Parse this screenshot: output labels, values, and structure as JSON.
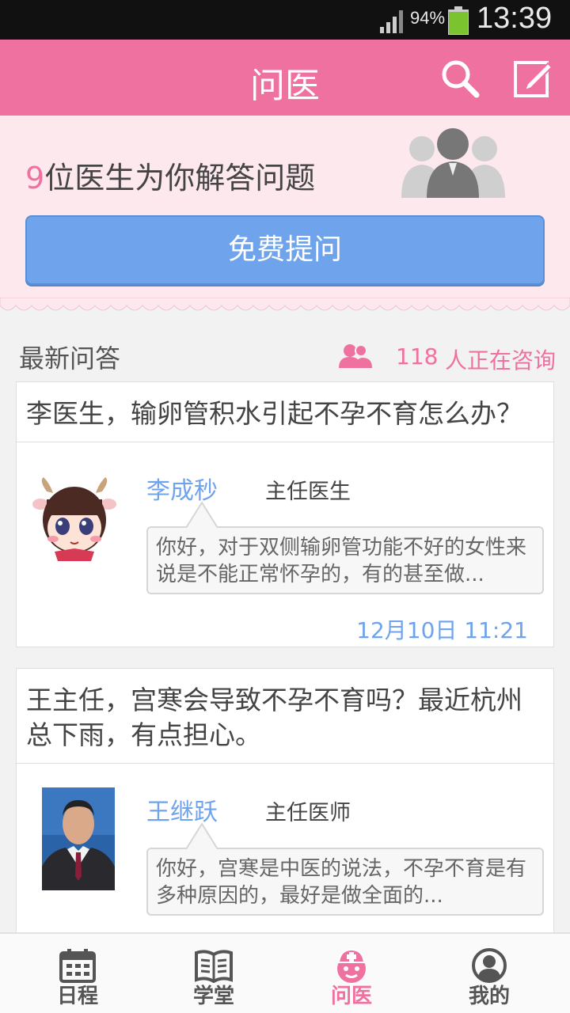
{
  "status_bar": {
    "battery": "94%",
    "time": "13:39"
  },
  "header": {
    "title": "问医",
    "search_icon": "search-icon",
    "compose_icon": "compose-icon"
  },
  "banner": {
    "doctor_count": "9",
    "text": "位医生为你解答问题",
    "ask_button": "免费提问",
    "icon": "doctors-group-icon"
  },
  "section": {
    "title": "最新问答",
    "online_count": "118",
    "online_text": "人正在咨询",
    "icon": "people-icon"
  },
  "questions": [
    {
      "question": "李医生，输卵管积水引起不孕不育怎么办？",
      "doctor_name": "李成秒",
      "doctor_title": "主任医生",
      "answer": "你好，对于双侧输卵管功能不好的女性来说是不能正常怀孕的，有的甚至做...",
      "time": "12月10日 11:21",
      "avatar": "cartoon-girl-avatar"
    },
    {
      "question": "王主任，宫寒会导致不孕不育吗？最近杭州总下雨，有点担心。",
      "doctor_name": "王继跃",
      "doctor_title": "主任医师",
      "answer": "你好，宫寒是中医的说法，不孕不育是有多种原因的，最好是做全面的...",
      "avatar": "doctor-photo-avatar"
    }
  ],
  "nav": [
    {
      "label": "日程",
      "icon": "calendar-icon"
    },
    {
      "label": "学堂",
      "icon": "book-icon"
    },
    {
      "label": "问医",
      "icon": "nurse-icon",
      "active": true
    },
    {
      "label": "我的",
      "icon": "profile-icon"
    }
  ],
  "colors": {
    "accent": "#ef71a0",
    "button": "#6fa3ec",
    "banner_bg": "#fde8ee"
  }
}
